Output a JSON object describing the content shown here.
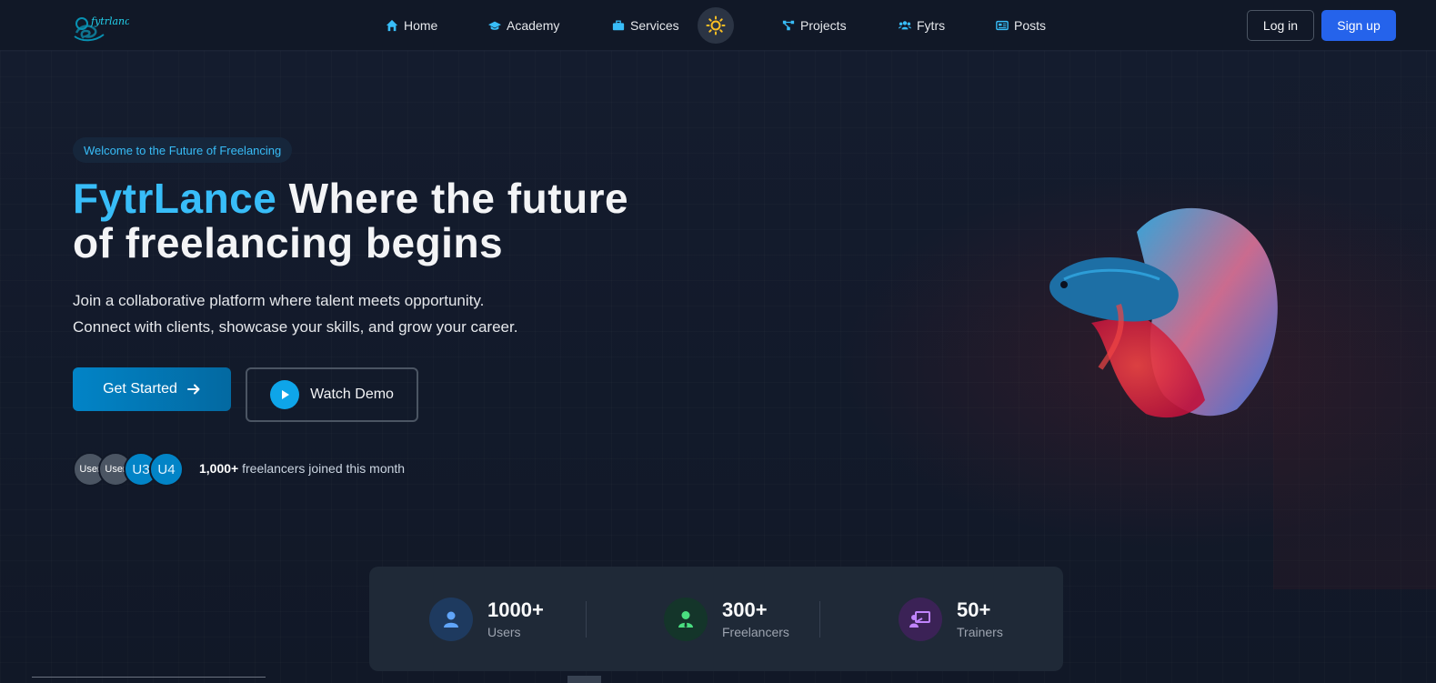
{
  "nav": {
    "logo_text": "fytrlance",
    "items": [
      {
        "label": "Home",
        "icon": "home-icon"
      },
      {
        "label": "Academy",
        "icon": "graduation-cap-icon"
      },
      {
        "label": "Services",
        "icon": "briefcase-icon"
      },
      {
        "label": "Projects",
        "icon": "project-diagram-icon"
      },
      {
        "label": "Fytrs",
        "icon": "users-icon"
      },
      {
        "label": "Posts",
        "icon": "newspaper-icon"
      }
    ],
    "theme_toggle_icon": "sun-icon",
    "login_label": "Log in",
    "signup_label": "Sign up"
  },
  "hero": {
    "badge": "Welcome to the Future of Freelancing",
    "brand": "FytrLance",
    "headline_rest_1": "Where the future",
    "headline_rest_2": "of freelancing begins",
    "subtext_1": "Join a collaborative platform where talent meets opportunity.",
    "subtext_2": "Connect with clients, showcase your skills, and grow your career.",
    "cta_primary": "Get Started",
    "cta_secondary": "Watch Demo",
    "avatars": [
      "User",
      "User",
      "U3",
      "U4"
    ],
    "joined_count": "1,000+",
    "joined_text": "freelancers joined this month"
  },
  "stats": [
    {
      "value": "1000+",
      "label": "Users",
      "icon": "user-icon",
      "color": "#60a5fa"
    },
    {
      "value": "300+",
      "label": "Freelancers",
      "icon": "user-tie-icon",
      "color": "#4ade80"
    },
    {
      "value": "50+",
      "label": "Trainers",
      "icon": "chalkboard-teacher-icon",
      "color": "#c084fc"
    }
  ],
  "colors": {
    "accent": "#38bdf8",
    "primary_button": "#2563eb",
    "background": "#111827"
  }
}
